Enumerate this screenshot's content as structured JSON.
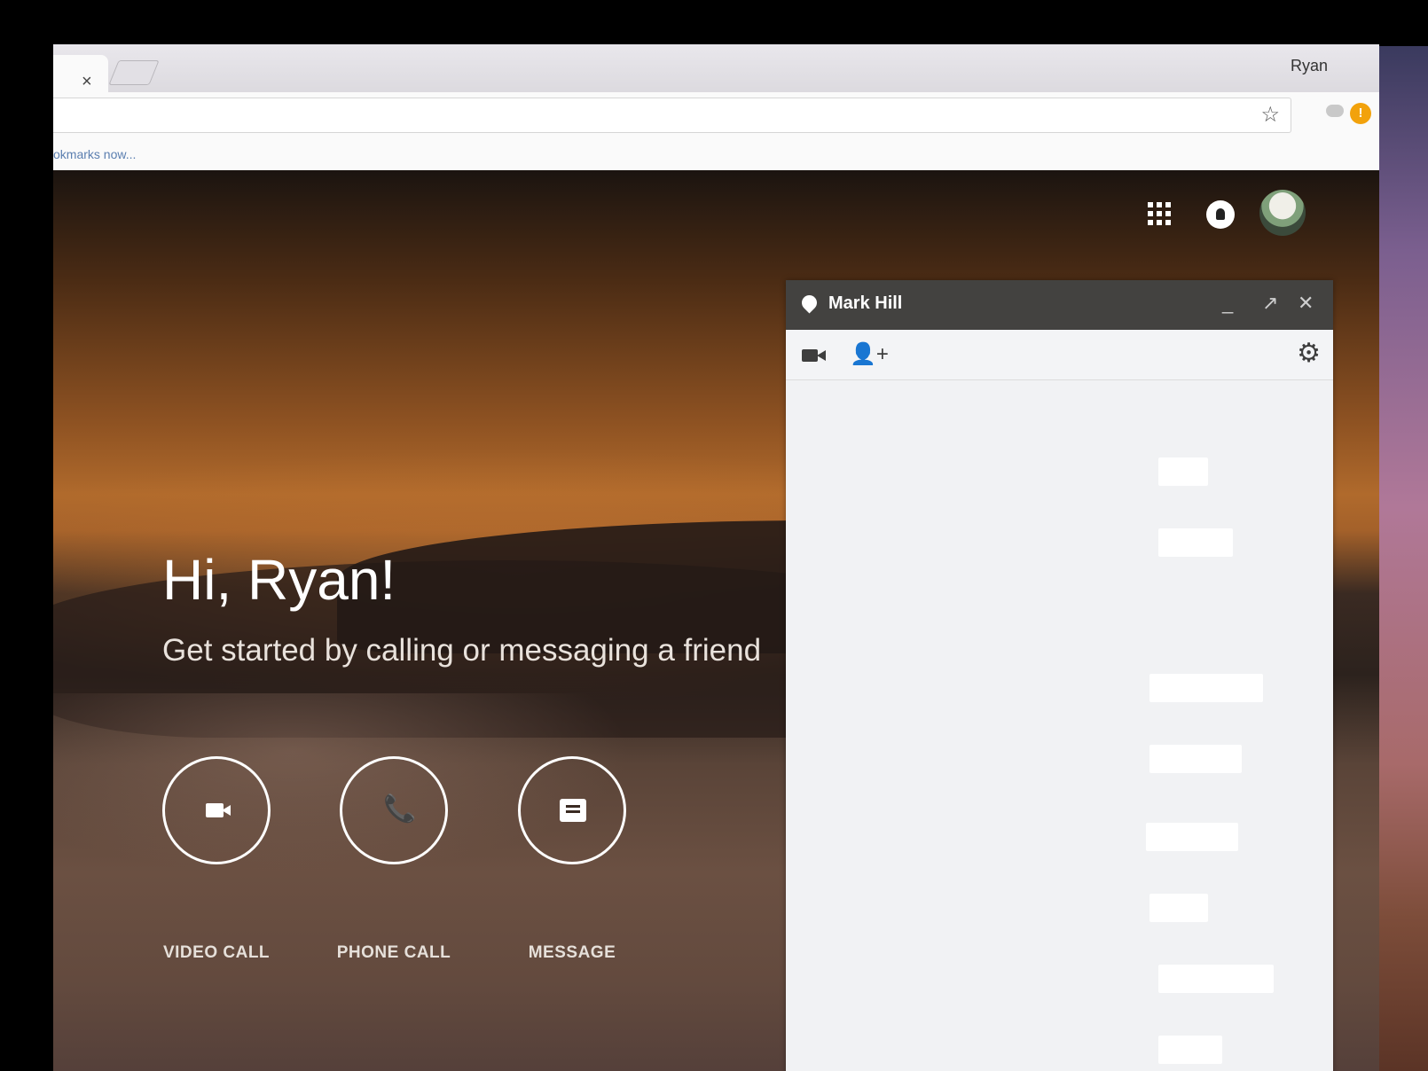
{
  "browser": {
    "tab_close": "×",
    "profile_name": "Ryan",
    "bookmarks_text": "okmarks now...",
    "star": "☆",
    "ext_alert": "!"
  },
  "hero": {
    "title": "Hi, Ryan!",
    "subtitle": "Get started by calling or messaging a friend"
  },
  "actions": [
    {
      "label": "VIDEO CALL"
    },
    {
      "label": "PHONE CALL"
    },
    {
      "label": "MESSAGE"
    }
  ],
  "chat": {
    "contact_name": "Mark Hill",
    "minimize": "_",
    "popout": "↗",
    "close": "✕",
    "add_user": "👤+",
    "settings": "⚙"
  },
  "icons": {
    "phone": "📞",
    "apps": "apps-grid-icon",
    "notifications": "notifications-icon"
  },
  "colors": {
    "chat_header": "#434240",
    "chat_body": "#f1f2f4",
    "alert": "#f2a20c"
  }
}
